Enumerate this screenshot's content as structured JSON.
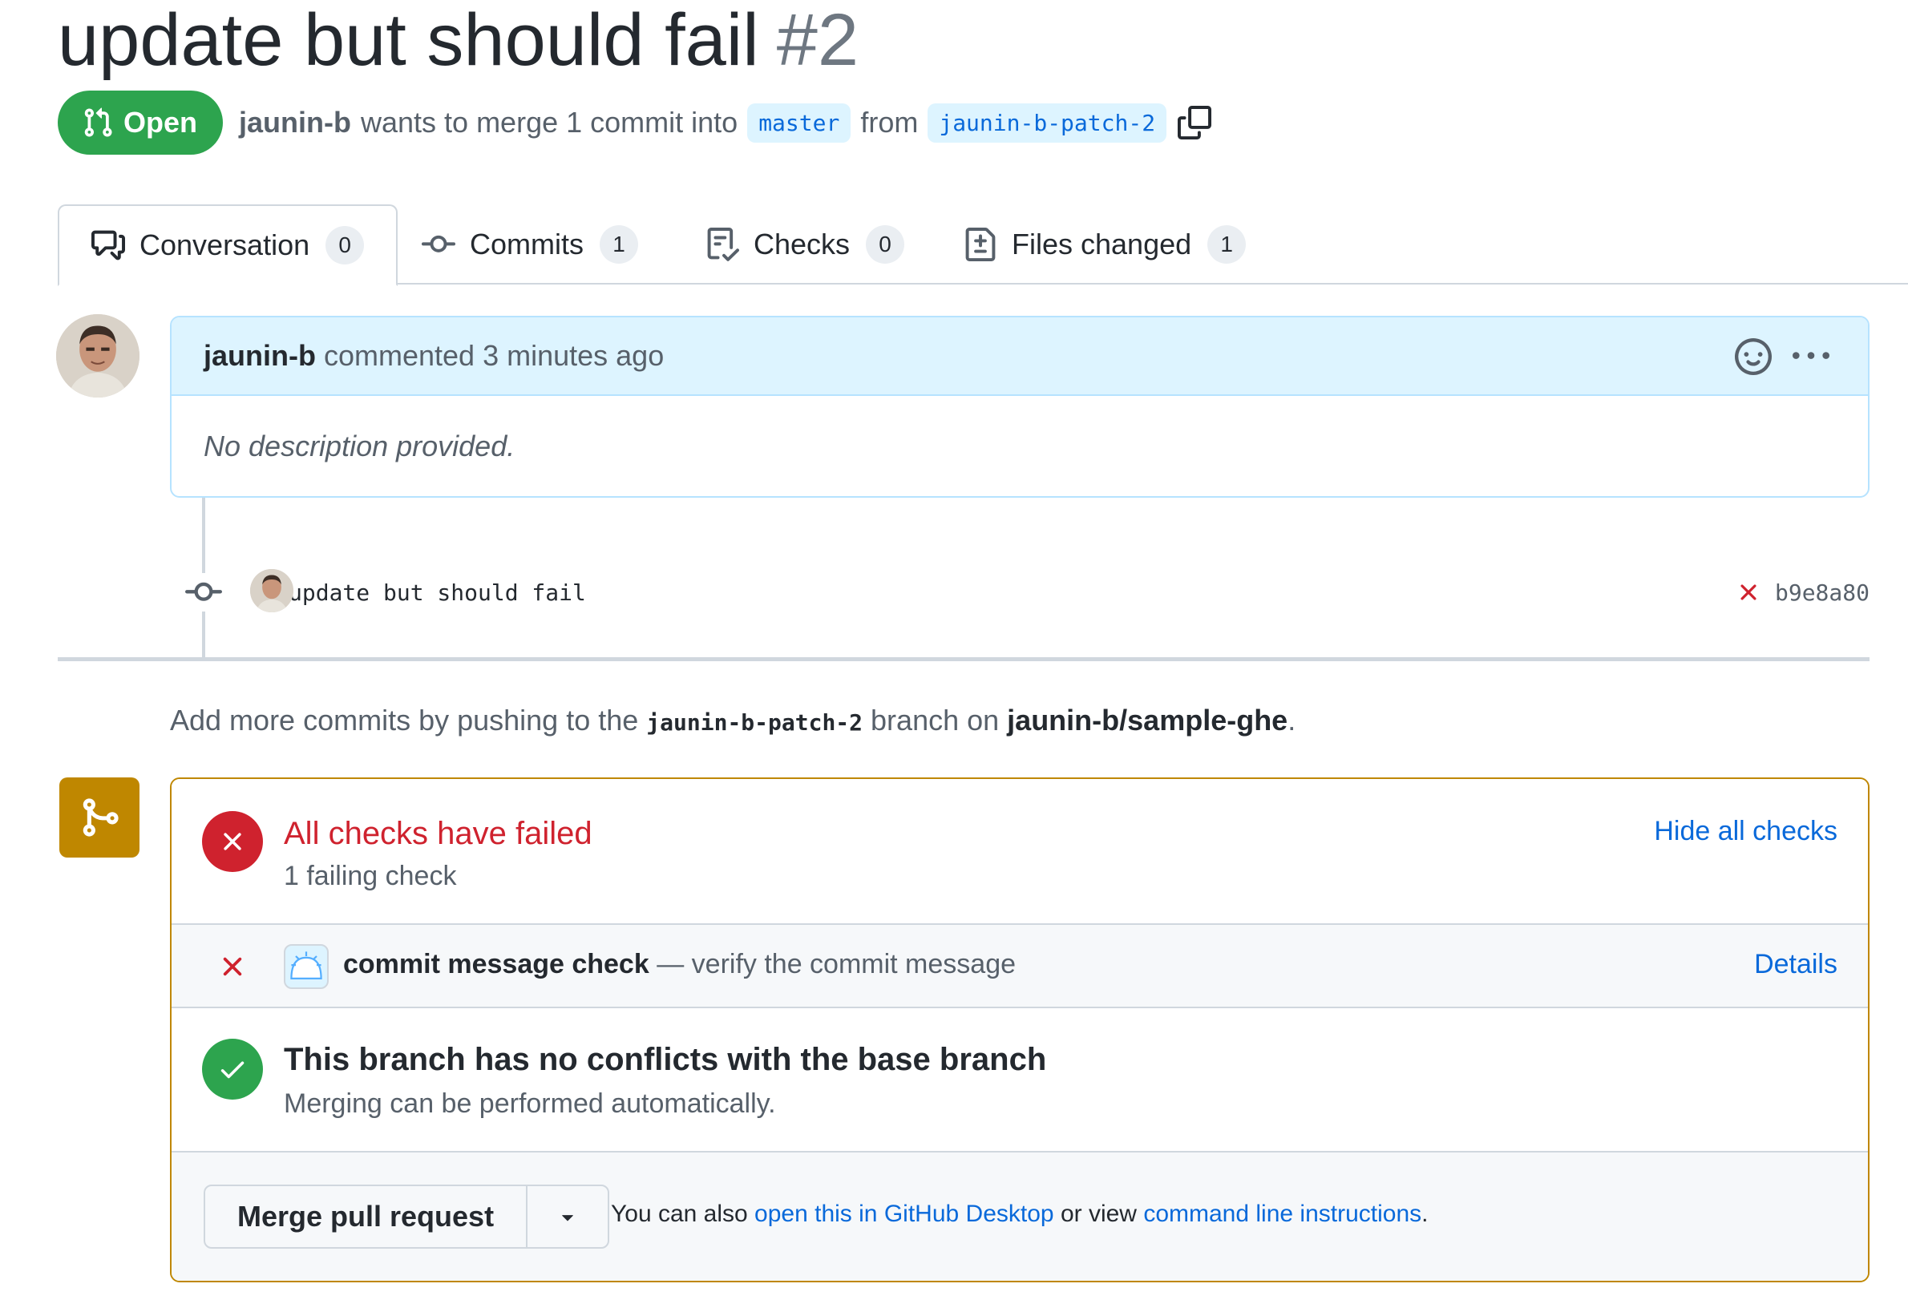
{
  "pr": {
    "title": "update but should fail",
    "number": "#2",
    "state": "Open",
    "author": "jaunin-b",
    "merge_text": "wants to merge 1 commit into",
    "base_branch": "master",
    "from_text": "from",
    "head_branch": "jaunin-b-patch-2"
  },
  "tabs": [
    {
      "label": "Conversation",
      "count": "0"
    },
    {
      "label": "Commits",
      "count": "1"
    },
    {
      "label": "Checks",
      "count": "0"
    },
    {
      "label": "Files changed",
      "count": "1"
    }
  ],
  "comment": {
    "author": "jaunin-b",
    "meta": "commented 3 minutes ago",
    "body": "No description provided."
  },
  "commit": {
    "message": "update but should fail",
    "sha": "b9e8a80"
  },
  "add_more": {
    "prefix": "Add more commits by pushing to the",
    "branch": "jaunin-b-patch-2",
    "middle": "branch on",
    "repo": "jaunin-b/sample-ghe",
    "suffix": "."
  },
  "checks": {
    "title": "All checks have failed",
    "subtitle": "1 failing check",
    "toggle_label": "Hide all checks",
    "item_name": "commit message check",
    "item_desc": "— verify the commit message",
    "item_link": "Details"
  },
  "conflicts": {
    "title": "This branch has no conflicts with the base branch",
    "subtitle": "Merging can be performed automatically."
  },
  "merge": {
    "button_label": "Merge pull request",
    "note_prefix": "You can also",
    "desktop_link": "open this in GitHub Desktop",
    "note_middle": "or view",
    "cli_link": "command line instructions",
    "note_suffix": "."
  },
  "colors": {
    "open_green": "#2da44e",
    "fail_red": "#cf222e",
    "link_blue": "#0969da",
    "merge_border": "#bf8700"
  }
}
